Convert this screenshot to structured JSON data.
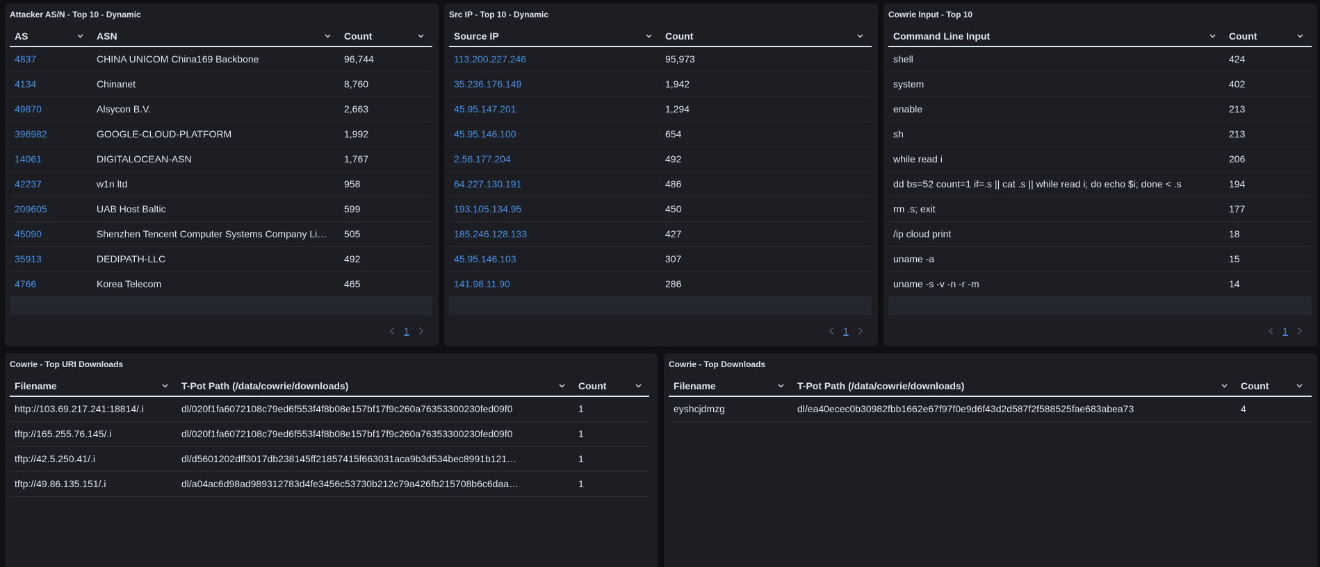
{
  "colors": {
    "background": "#0f1014",
    "panel": "#1d1e24",
    "link": "#4a8fe0",
    "text": "#dfe5ef",
    "muted": "#535966"
  },
  "asn_panel": {
    "title": "Attacker AS/N - Top 10 - Dynamic",
    "columns": [
      "AS",
      "ASN",
      "Count"
    ],
    "rows": [
      [
        "4837",
        "CHINA UNICOM China169 Backbone",
        "96,744"
      ],
      [
        "4134",
        "Chinanet",
        "8,760"
      ],
      [
        "49870",
        "Alsycon B.V.",
        "2,663"
      ],
      [
        "396982",
        "GOOGLE-CLOUD-PLATFORM",
        "1,992"
      ],
      [
        "14061",
        "DIGITALOCEAN-ASN",
        "1,767"
      ],
      [
        "42237",
        "w1n ltd",
        "958"
      ],
      [
        "209605",
        "UAB Host Baltic",
        "599"
      ],
      [
        "45090",
        "Shenzhen Tencent Computer Systems Company Limited",
        "505"
      ],
      [
        "35913",
        "DEDIPATH-LLC",
        "492"
      ],
      [
        "4766",
        "Korea Telecom",
        "465"
      ]
    ],
    "page": "1"
  },
  "srcip_panel": {
    "title": "Src IP - Top 10 - Dynamic",
    "columns": [
      "Source IP",
      "Count"
    ],
    "rows": [
      [
        "113.200.227.246",
        "95,973"
      ],
      [
        "35.236.176.149",
        "1,942"
      ],
      [
        "45.95.147.201",
        "1,294"
      ],
      [
        "45.95.146.100",
        "654"
      ],
      [
        "2.56.177.204",
        "492"
      ],
      [
        "64.227.130.191",
        "486"
      ],
      [
        "193.105.134.95",
        "450"
      ],
      [
        "185.246.128.133",
        "427"
      ],
      [
        "45.95.146.103",
        "307"
      ],
      [
        "141.98.11.90",
        "286"
      ]
    ],
    "page": "1"
  },
  "input_panel": {
    "title": "Cowrie Input - Top 10",
    "columns": [
      "Command Line Input",
      "Count"
    ],
    "rows": [
      [
        "shell",
        "424"
      ],
      [
        "system",
        "402"
      ],
      [
        "enable",
        "213"
      ],
      [
        "sh",
        "213"
      ],
      [
        "while read i",
        "206"
      ],
      [
        "dd bs=52 count=1 if=.s || cat .s || while read i; do echo $i; done < .s",
        "194"
      ],
      [
        "rm .s; exit",
        "177"
      ],
      [
        "/ip cloud print",
        "18"
      ],
      [
        "uname -a",
        "15"
      ],
      [
        "uname -s -v -n -r -m",
        "14"
      ]
    ],
    "page": "1"
  },
  "uri_panel": {
    "title": "Cowrie - Top URI Downloads",
    "columns": [
      "Filename",
      "T-Pot Path (/data/cowrie/downloads)",
      "Count"
    ],
    "rows": [
      [
        "http://103.69.217.241:18814/.i",
        "dl/020f1fa6072108c79ed6f553f4f8b08e157bf17f9c260a76353300230fed09f0",
        "1"
      ],
      [
        "tftp://165.255.76.145/.i",
        "dl/020f1fa6072108c79ed6f553f4f8b08e157bf17f9c260a76353300230fed09f0",
        "1"
      ],
      [
        "tftp://42.5.250.41/.i",
        "dl/d5601202dff3017db238145ff21857415f663031aca9b3d534bec8991b121…",
        "1"
      ],
      [
        "tftp://49.86.135.151/.i",
        "dl/a04ac6d98ad989312783d4fe3456c53730b212c79a426fb215708b6c6daa…",
        "1"
      ]
    ]
  },
  "downloads_panel": {
    "title": "Cowrie - Top Downloads",
    "columns": [
      "Filename",
      "T-Pot Path (/data/cowrie/downloads)",
      "Count"
    ],
    "rows": [
      [
        "eyshcjdmzg",
        "dl/ea40ecec0b30982fbb1662e67f97f0e9d6f43d2d587f2f588525fae683abea73",
        "4"
      ]
    ]
  }
}
